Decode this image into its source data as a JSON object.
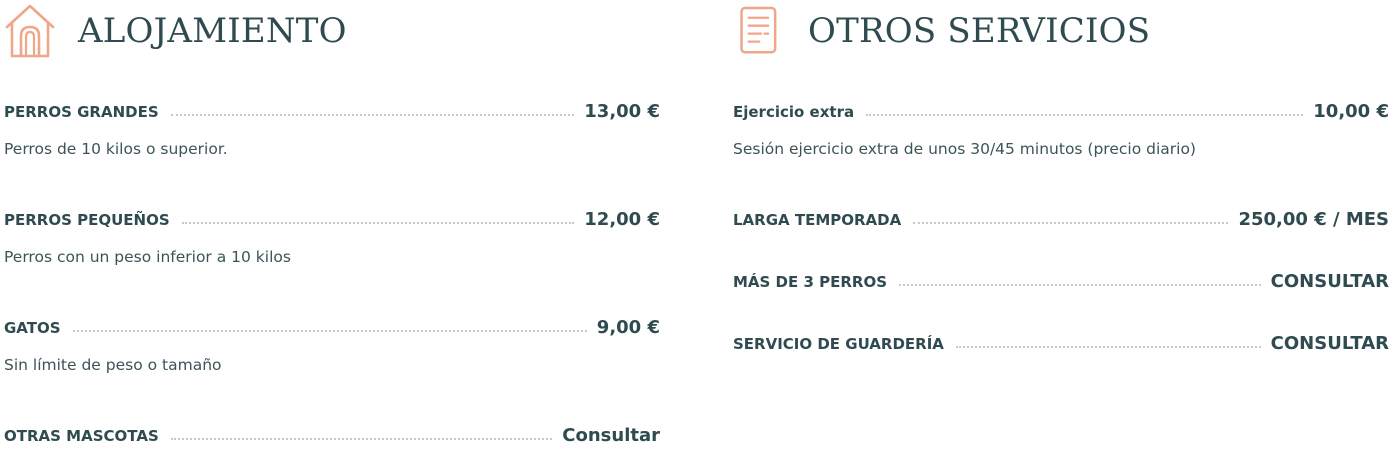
{
  "colors": {
    "accent": "#f0a689",
    "text": "#2f4b4f",
    "dots": "#c9c9c9"
  },
  "alojamiento": {
    "icon": "house-icon",
    "title": "ALOJAMIENTO",
    "items": [
      {
        "name": "PERROS GRANDES",
        "price": "13,00 €",
        "description": "Perros de 10 kilos o superior."
      },
      {
        "name": "PERROS PEQUEÑOS",
        "price": "12,00 €",
        "description": "Perros con un peso inferior a 10 kilos"
      },
      {
        "name": "GATOS",
        "price": "9,00 €",
        "description": "Sin límite de peso o tamaño"
      },
      {
        "name": "OTRAS MASCOTAS",
        "price": "Consultar"
      }
    ]
  },
  "otros_servicios": {
    "icon": "document-icon",
    "title": "OTROS SERVICIOS",
    "items": [
      {
        "name": "Ejercicio extra",
        "price": "10,00 €",
        "description": "Sesión ejercicio extra de unos 30/45 minutos (precio diario)"
      },
      {
        "name": "LARGA TEMPORADA",
        "price": "250,00 € / MES"
      },
      {
        "name": "MÁS DE 3 PERROS",
        "price": "CONSULTAR"
      },
      {
        "name": "SERVICIO DE GUARDERÍA",
        "price": "CONSULTAR"
      }
    ]
  }
}
